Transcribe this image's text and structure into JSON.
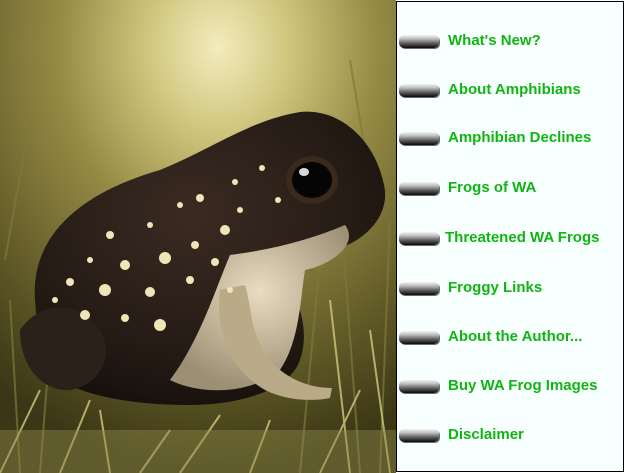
{
  "photo": {
    "description_name": "spotted-frog-photo"
  },
  "menu": {
    "items": [
      {
        "label": "What's New?"
      },
      {
        "label": "About Amphibians"
      },
      {
        "label": "Amphibian Declines"
      },
      {
        "label": "Frogs of WA"
      },
      {
        "label": "Threatened WA Frogs"
      },
      {
        "label": "Froggy Links"
      },
      {
        "label": "About the Author..."
      },
      {
        "label": "Buy WA Frog Images"
      },
      {
        "label": "Disclaimer"
      }
    ],
    "label_color": "#11b511",
    "panel_color": "#f7ffff"
  }
}
